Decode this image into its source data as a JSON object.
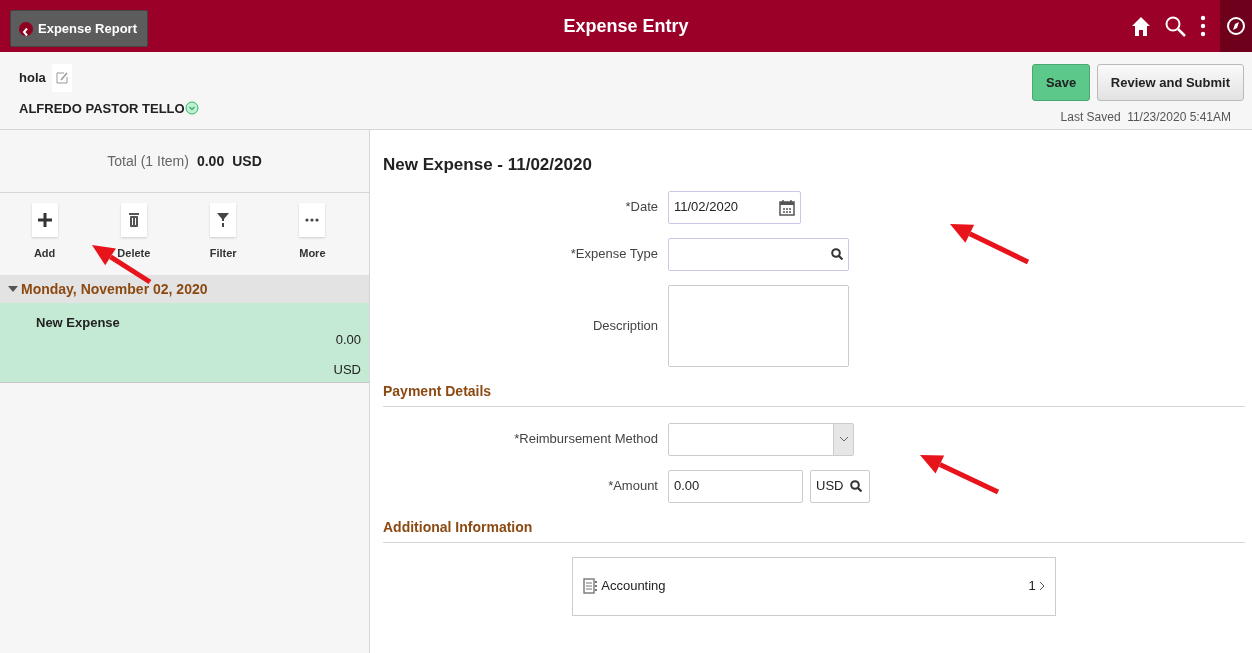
{
  "top_bar": {
    "back_button": "Expense Report",
    "title": "Expense Entry"
  },
  "report": {
    "name": "hola",
    "employee": "ALFREDO PASTOR TELLO",
    "save_button": "Save",
    "submit_button": "Review and Submit",
    "last_saved_label": "Last Saved",
    "last_saved": "11/23/2020 5:41AM"
  },
  "summary": {
    "total_label": "Total (1 Item)",
    "total_amount": "0.00",
    "total_currency": "USD"
  },
  "toolbar": [
    {
      "kind": "add",
      "label": "Add"
    },
    {
      "kind": "delete",
      "label": "Delete"
    },
    {
      "kind": "filter",
      "label": "Filter"
    },
    {
      "kind": "more",
      "label": "More"
    }
  ],
  "groups": [
    {
      "date": "Monday, November 02, 2020",
      "expanded": true,
      "items": [
        {
          "title": "New Expense",
          "amount": "0.00",
          "currency": "USD",
          "selected": true
        }
      ]
    }
  ],
  "form": {
    "title": "New Expense - 11/02/2020",
    "fields": [
      {
        "kind": "date",
        "label": "*Date",
        "value": "11/02/2020"
      },
      {
        "kind": "lookup",
        "label": "*Expense Type"
      },
      {
        "kind": "textarea",
        "label": "Description"
      }
    ]
  },
  "sections": [
    {
      "title": "Payment Details",
      "fields": [
        {
          "kind": "select",
          "label": "*Reimbursement Method"
        },
        {
          "kind": "amount",
          "label": "*Amount",
          "value": "0.00",
          "currency": "USD"
        }
      ]
    },
    {
      "title": "Additional Information",
      "links": [
        {
          "label": "Accounting",
          "count": "1"
        }
      ]
    }
  ],
  "annotation_arrows": [
    {
      "kind": "arrow"
    },
    {
      "kind": "arrow"
    },
    {
      "kind": "arrow"
    }
  ]
}
